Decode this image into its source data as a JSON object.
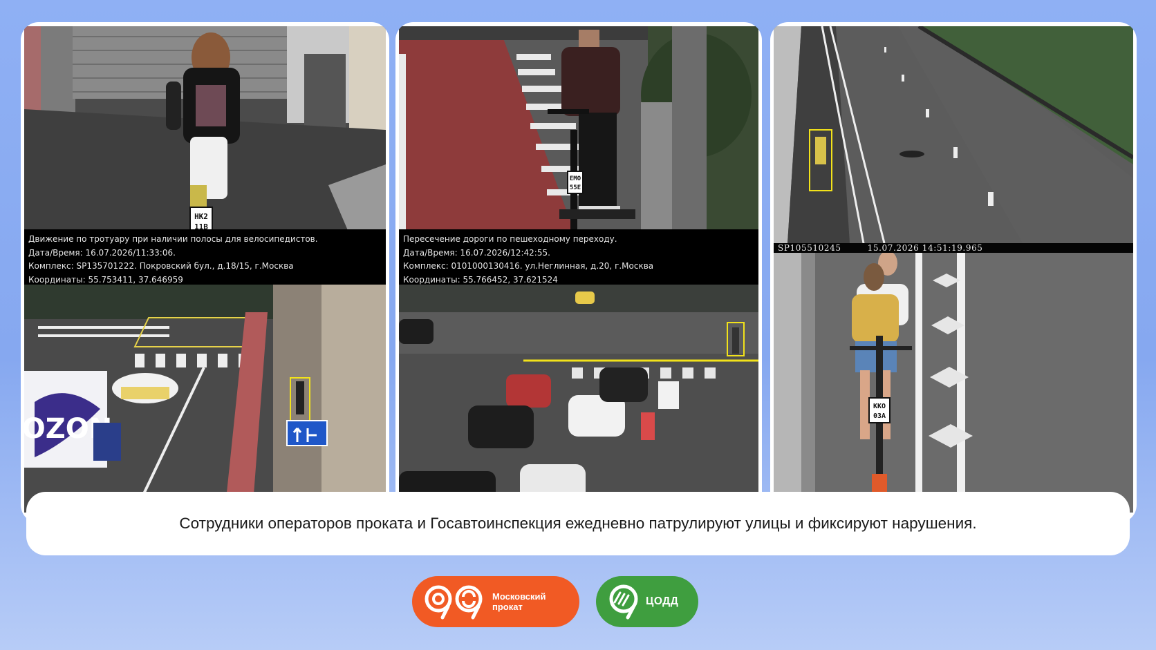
{
  "caption": "Сотрудники операторов проката и Госавтоинспекция ежедневно патрулируют улицы и фиксируют нарушения.",
  "violations": [
    {
      "title": "Движение по тротуару при наличии полосы для велосипедистов.",
      "datetime": "Дата/Время: 16.07.2026/11:33:06.",
      "complex": "Комплекс: SP135701222. Покровский бул., д.18/15, г.Москва",
      "coords": "Координаты: 55.753411, 37.646959",
      "plate_line1": "HK2",
      "plate_line2": "11B",
      "truck_brand": "OZON"
    },
    {
      "title": "Пересечение дороги по пешеходному переходу.",
      "datetime": "Дата/Время: 16.07.2026/12:42:55.",
      "complex": "Комплекс: 0101000130416. ул.Неглинная, д.20, г.Москва",
      "coords": "Координаты: 55.766452, 37.621524",
      "plate_line1": "EMO",
      "plate_line2": "55E"
    }
  ],
  "camera3": {
    "device": "SP105510245",
    "timestamp": "15.07.2026 14:51:19.965",
    "plate_line1": "KKO",
    "plate_line2": "03A"
  },
  "logos": {
    "moscow_rental_line1": "Московский",
    "moscow_rental_line2": "прокат",
    "codd": "ЦОДД"
  },
  "colors": {
    "background": "#8fb0f4",
    "moscow_rental": "#f15a24",
    "codd": "#3f9e3f",
    "detection_box": "#f2e21a"
  }
}
